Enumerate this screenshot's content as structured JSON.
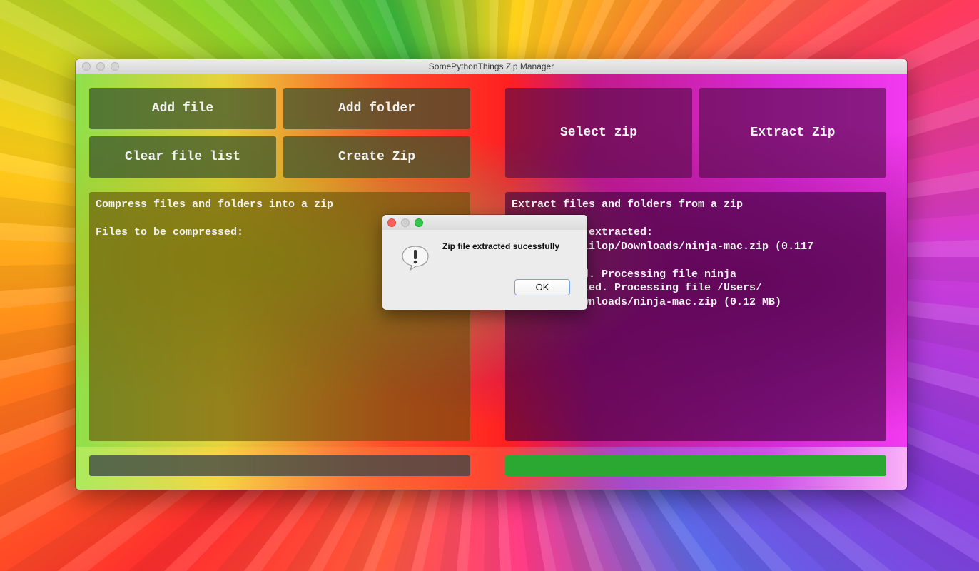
{
  "window": {
    "title": "SomePythonThings Zip Manager"
  },
  "compress": {
    "add_file": "Add file",
    "add_folder": "Add folder",
    "clear_list": "Clear file list",
    "create_zip": "Create Zip",
    "log": "Compress files and folders into a zip\n\nFiles to be compressed:",
    "progress_percent": 0
  },
  "extract": {
    "select_zip": "Select zip",
    "extract_zip": "Extract Zip",
    "log": "Extract files and folders from a zip\n\nFiles to be extracted:\n /Users/ciclilop/Downloads/ninja-mac.zip (0.117\n MB)\n0% completed. Processing file ninja\n100% completed. Processing file /Users/\nciclilop/Downloads/ninja-mac.zip (0.12 MB)",
    "progress_percent": 100
  },
  "dialog": {
    "message": "Zip file extracted sucessfully",
    "ok_label": "OK",
    "icon": "alert-icon"
  },
  "colors": {
    "progress_fill": "#2aa832"
  }
}
